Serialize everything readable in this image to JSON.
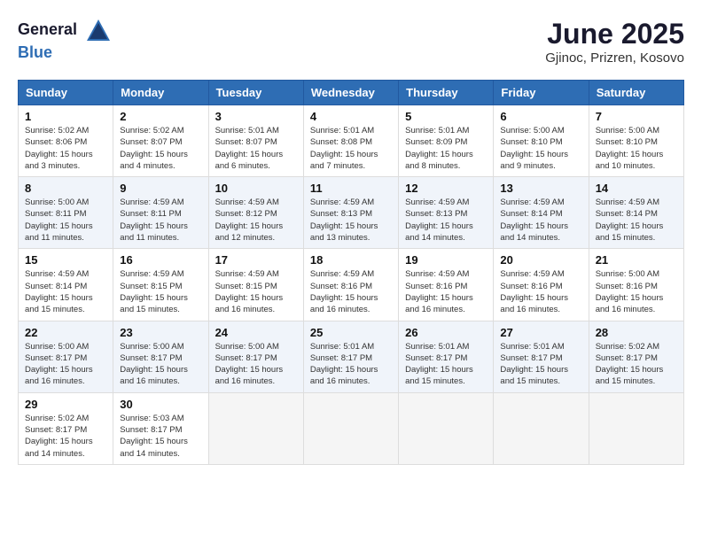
{
  "header": {
    "logo_general": "General",
    "logo_blue": "Blue",
    "title": "June 2025",
    "subtitle": "Gjinoc, Prizren, Kosovo"
  },
  "calendar": {
    "days_of_week": [
      "Sunday",
      "Monday",
      "Tuesday",
      "Wednesday",
      "Thursday",
      "Friday",
      "Saturday"
    ],
    "weeks": [
      [
        {
          "day": "1",
          "sunrise": "5:02 AM",
          "sunset": "8:06 PM",
          "daylight": "15 hours and 3 minutes."
        },
        {
          "day": "2",
          "sunrise": "5:02 AM",
          "sunset": "8:07 PM",
          "daylight": "15 hours and 4 minutes."
        },
        {
          "day": "3",
          "sunrise": "5:01 AM",
          "sunset": "8:07 PM",
          "daylight": "15 hours and 6 minutes."
        },
        {
          "day": "4",
          "sunrise": "5:01 AM",
          "sunset": "8:08 PM",
          "daylight": "15 hours and 7 minutes."
        },
        {
          "day": "5",
          "sunrise": "5:01 AM",
          "sunset": "8:09 PM",
          "daylight": "15 hours and 8 minutes."
        },
        {
          "day": "6",
          "sunrise": "5:00 AM",
          "sunset": "8:10 PM",
          "daylight": "15 hours and 9 minutes."
        },
        {
          "day": "7",
          "sunrise": "5:00 AM",
          "sunset": "8:10 PM",
          "daylight": "15 hours and 10 minutes."
        }
      ],
      [
        {
          "day": "8",
          "sunrise": "5:00 AM",
          "sunset": "8:11 PM",
          "daylight": "15 hours and 11 minutes."
        },
        {
          "day": "9",
          "sunrise": "4:59 AM",
          "sunset": "8:11 PM",
          "daylight": "15 hours and 11 minutes."
        },
        {
          "day": "10",
          "sunrise": "4:59 AM",
          "sunset": "8:12 PM",
          "daylight": "15 hours and 12 minutes."
        },
        {
          "day": "11",
          "sunrise": "4:59 AM",
          "sunset": "8:13 PM",
          "daylight": "15 hours and 13 minutes."
        },
        {
          "day": "12",
          "sunrise": "4:59 AM",
          "sunset": "8:13 PM",
          "daylight": "15 hours and 14 minutes."
        },
        {
          "day": "13",
          "sunrise": "4:59 AM",
          "sunset": "8:14 PM",
          "daylight": "15 hours and 14 minutes."
        },
        {
          "day": "14",
          "sunrise": "4:59 AM",
          "sunset": "8:14 PM",
          "daylight": "15 hours and 15 minutes."
        }
      ],
      [
        {
          "day": "15",
          "sunrise": "4:59 AM",
          "sunset": "8:14 PM",
          "daylight": "15 hours and 15 minutes."
        },
        {
          "day": "16",
          "sunrise": "4:59 AM",
          "sunset": "8:15 PM",
          "daylight": "15 hours and 15 minutes."
        },
        {
          "day": "17",
          "sunrise": "4:59 AM",
          "sunset": "8:15 PM",
          "daylight": "15 hours and 16 minutes."
        },
        {
          "day": "18",
          "sunrise": "4:59 AM",
          "sunset": "8:16 PM",
          "daylight": "15 hours and 16 minutes."
        },
        {
          "day": "19",
          "sunrise": "4:59 AM",
          "sunset": "8:16 PM",
          "daylight": "15 hours and 16 minutes."
        },
        {
          "day": "20",
          "sunrise": "4:59 AM",
          "sunset": "8:16 PM",
          "daylight": "15 hours and 16 minutes."
        },
        {
          "day": "21",
          "sunrise": "5:00 AM",
          "sunset": "8:16 PM",
          "daylight": "15 hours and 16 minutes."
        }
      ],
      [
        {
          "day": "22",
          "sunrise": "5:00 AM",
          "sunset": "8:17 PM",
          "daylight": "15 hours and 16 minutes."
        },
        {
          "day": "23",
          "sunrise": "5:00 AM",
          "sunset": "8:17 PM",
          "daylight": "15 hours and 16 minutes."
        },
        {
          "day": "24",
          "sunrise": "5:00 AM",
          "sunset": "8:17 PM",
          "daylight": "15 hours and 16 minutes."
        },
        {
          "day": "25",
          "sunrise": "5:01 AM",
          "sunset": "8:17 PM",
          "daylight": "15 hours and 16 minutes."
        },
        {
          "day": "26",
          "sunrise": "5:01 AM",
          "sunset": "8:17 PM",
          "daylight": "15 hours and 15 minutes."
        },
        {
          "day": "27",
          "sunrise": "5:01 AM",
          "sunset": "8:17 PM",
          "daylight": "15 hours and 15 minutes."
        },
        {
          "day": "28",
          "sunrise": "5:02 AM",
          "sunset": "8:17 PM",
          "daylight": "15 hours and 15 minutes."
        }
      ],
      [
        {
          "day": "29",
          "sunrise": "5:02 AM",
          "sunset": "8:17 PM",
          "daylight": "15 hours and 14 minutes."
        },
        {
          "day": "30",
          "sunrise": "5:03 AM",
          "sunset": "8:17 PM",
          "daylight": "15 hours and 14 minutes."
        },
        null,
        null,
        null,
        null,
        null
      ]
    ]
  }
}
